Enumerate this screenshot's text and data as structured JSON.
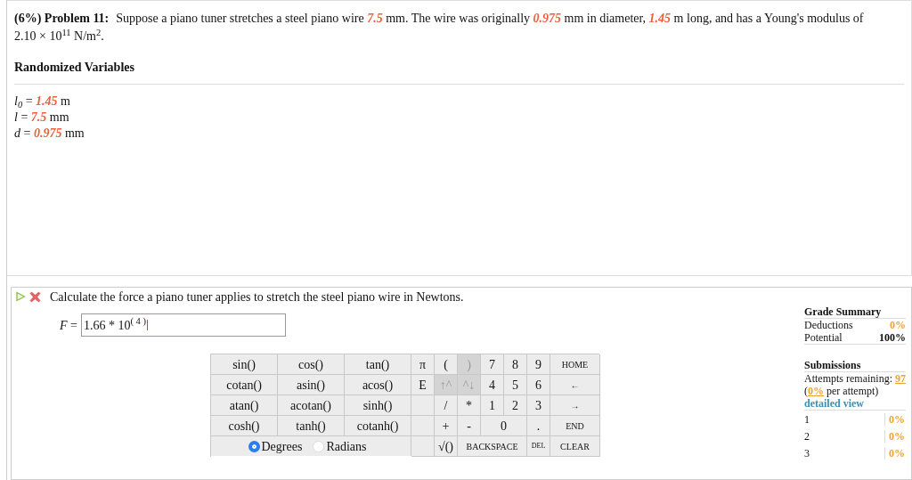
{
  "problem": {
    "header": "(6%) Problem 11:",
    "statement": "Suppose a piano tuner stretches a steel piano wire *7.5* mm. The wire was originally *0.975* mm in diameter, *1.45* m long, and has a Young's modulus of 2.10 × 10$^{11}$ N/m$^{2}$."
  },
  "randomized_variables": {
    "title": "Randomized Variables",
    "items": [
      {
        "symbol": "l$_{0}$",
        "relation": "=",
        "value": "1.45",
        "unit": "m"
      },
      {
        "symbol": "l",
        "relation": "=",
        "value": "7.5",
        "unit": "mm"
      },
      {
        "symbol": "d",
        "relation": "=",
        "value": "0.975",
        "unit": "mm"
      }
    ]
  },
  "question": {
    "text": "Calculate the force a piano tuner applies to stretch the steel piano wire in Newtons.",
    "answer_label": "*F* =",
    "answer_value": "1.66 * 10$^{( 4 )}$"
  },
  "keypad": {
    "rows": [
      [
        {
          "kind": "fn",
          "label": "sin()"
        },
        {
          "kind": "fn",
          "label": "cos()"
        },
        {
          "kind": "fn",
          "label": "tan()"
        },
        {
          "kind": "key",
          "label": "π",
          "disabled": false
        },
        {
          "kind": "key",
          "label": "(",
          "disabled": false
        },
        {
          "kind": "key",
          "label": ")",
          "disabled": true
        },
        {
          "kind": "key",
          "label": "7",
          "disabled": false
        },
        {
          "kind": "key",
          "label": "8",
          "disabled": false
        },
        {
          "kind": "key",
          "label": "9",
          "disabled": false
        },
        {
          "kind": "nav",
          "label": "HOME"
        }
      ],
      [
        {
          "kind": "fn",
          "label": "cotan()"
        },
        {
          "kind": "fn",
          "label": "asin()"
        },
        {
          "kind": "fn",
          "label": "acos()"
        },
        {
          "kind": "key",
          "label": "E",
          "disabled": false
        },
        {
          "kind": "key",
          "label": "↑^",
          "disabled": true
        },
        {
          "kind": "key",
          "label": "^↓",
          "disabled": true
        },
        {
          "kind": "key",
          "label": "4",
          "disabled": false
        },
        {
          "kind": "key",
          "label": "5",
          "disabled": false
        },
        {
          "kind": "key",
          "label": "6",
          "disabled": false
        },
        {
          "kind": "nav",
          "label": "←"
        }
      ],
      [
        {
          "kind": "fn",
          "label": "atan()"
        },
        {
          "kind": "fn",
          "label": "acotan()"
        },
        {
          "kind": "fn",
          "label": "sinh()"
        },
        {
          "kind": "blank"
        },
        {
          "kind": "key",
          "label": "/",
          "disabled": false
        },
        {
          "kind": "key",
          "label": "*",
          "disabled": false
        },
        {
          "kind": "key",
          "label": "1",
          "disabled": false
        },
        {
          "kind": "key",
          "label": "2",
          "disabled": false
        },
        {
          "kind": "key",
          "label": "3",
          "disabled": false
        },
        {
          "kind": "nav",
          "label": "→"
        }
      ],
      [
        {
          "kind": "fn",
          "label": "cosh()"
        },
        {
          "kind": "fn",
          "label": "tanh()"
        },
        {
          "kind": "fn",
          "label": "cotanh()"
        },
        {
          "kind": "blank"
        },
        {
          "kind": "key",
          "label": "+",
          "disabled": false
        },
        {
          "kind": "key",
          "label": "-",
          "disabled": false
        },
        {
          "kind": "wide",
          "label": "0",
          "colspan": 2
        },
        {
          "kind": "key",
          "label": ".",
          "disabled": false
        },
        {
          "kind": "nav",
          "label": "END"
        }
      ],
      [
        {
          "kind": "angle_mode",
          "colspan": 3,
          "options": [
            {
              "label": "Degrees",
              "selected": true
            },
            {
              "label": "Radians",
              "selected": false
            }
          ]
        },
        {
          "kind": "blank"
        },
        {
          "kind": "key",
          "label": "√()",
          "disabled": false
        },
        {
          "kind": "long",
          "label": "BACKSPACE",
          "colspan": 3
        },
        {
          "kind": "small",
          "label": "DEL"
        },
        {
          "kind": "nav",
          "label": "CLEAR"
        }
      ]
    ]
  },
  "grade_summary": {
    "title": "Grade Summary",
    "rows": [
      {
        "label": "Deductions",
        "value": "0%",
        "kind": "accent"
      },
      {
        "label": "Potential",
        "value": "100%",
        "kind": "plain"
      }
    ]
  },
  "submissions": {
    "title": "Submissions",
    "attempts_label": "Attempts remaining:",
    "attempts_value": "97",
    "per_attempt_open": "(",
    "per_attempt_value": "0%",
    "per_attempt_label": "per attempt)",
    "detailed_view": "detailed view",
    "rows": [
      {
        "number": "1",
        "value": "0%"
      },
      {
        "number": "2",
        "value": "0%"
      },
      {
        "number": "3",
        "value": "0%"
      }
    ]
  }
}
